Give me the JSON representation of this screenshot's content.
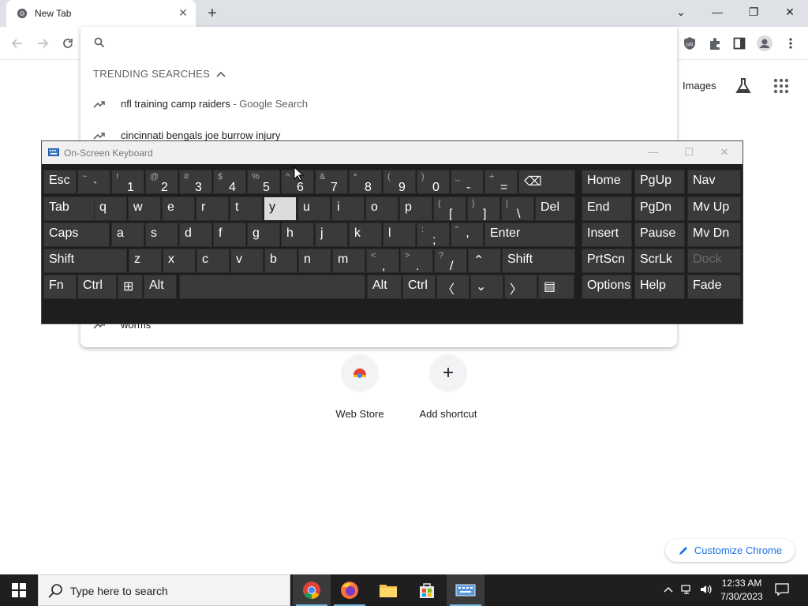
{
  "browser": {
    "tab_title": "New Tab",
    "tab_close": "✕",
    "new_tab": "+",
    "window_controls": {
      "dropdown": "⌄",
      "minimize": "—",
      "restore": "❐",
      "close": "✕"
    }
  },
  "omnibox": {
    "trending_header": "TRENDING SEARCHES",
    "suggestions": [
      {
        "text": "nfl training camp raiders",
        "suffix": " - Google Search"
      },
      {
        "text": "cincinnati bengals joe burrow injury",
        "suffix": ""
      },
      {
        "text": "worms",
        "suffix": ""
      }
    ]
  },
  "ntp": {
    "images_link": "Images",
    "shortcuts": [
      {
        "label": "Web Store"
      },
      {
        "label": "Add shortcut",
        "glyph": "+"
      }
    ],
    "customize": "Customize Chrome"
  },
  "osk": {
    "title": "On-Screen Keyboard",
    "window_controls": {
      "minimize": "—",
      "maximize": "☐",
      "close": "✕"
    },
    "rows": [
      [
        {
          "label": "Esc"
        },
        {
          "shift": "~",
          "main": "`"
        },
        {
          "shift": "!",
          "main": "1"
        },
        {
          "shift": "@",
          "main": "2"
        },
        {
          "shift": "#",
          "main": "3"
        },
        {
          "shift": "$",
          "main": "4"
        },
        {
          "shift": "%",
          "main": "5"
        },
        {
          "shift": "^",
          "main": "6"
        },
        {
          "shift": "&",
          "main": "7"
        },
        {
          "shift": "*",
          "main": "8"
        },
        {
          "shift": "(",
          "main": "9"
        },
        {
          "shift": ")",
          "main": "0"
        },
        {
          "shift": "_",
          "main": "-"
        },
        {
          "shift": "+",
          "main": "="
        },
        {
          "label": "⌫"
        },
        {
          "label": "Home"
        },
        {
          "label": "PgUp"
        },
        {
          "label": "Nav"
        }
      ],
      [
        {
          "label": "Tab"
        },
        {
          "label": "q"
        },
        {
          "label": "w"
        },
        {
          "label": "e"
        },
        {
          "label": "r"
        },
        {
          "label": "t"
        },
        {
          "label": "y",
          "pressed": true
        },
        {
          "label": "u"
        },
        {
          "label": "i"
        },
        {
          "label": "o"
        },
        {
          "label": "p"
        },
        {
          "shift": "{",
          "main": "["
        },
        {
          "shift": "}",
          "main": "]"
        },
        {
          "shift": "|",
          "main": "\\"
        },
        {
          "label": "Del"
        },
        {
          "label": "End"
        },
        {
          "label": "PgDn"
        },
        {
          "label": "Mv Up"
        }
      ],
      [
        {
          "label": "Caps"
        },
        {
          "label": "a"
        },
        {
          "label": "s"
        },
        {
          "label": "d"
        },
        {
          "label": "f"
        },
        {
          "label": "g"
        },
        {
          "label": "h"
        },
        {
          "label": "j"
        },
        {
          "label": "k"
        },
        {
          "label": "l"
        },
        {
          "shift": ":",
          "main": ";"
        },
        {
          "shift": "\"",
          "main": "'"
        },
        {
          "label": "Enter"
        },
        {
          "label": "Insert"
        },
        {
          "label": "Pause"
        },
        {
          "label": "Mv Dn"
        }
      ],
      [
        {
          "label": "Shift"
        },
        {
          "label": "z"
        },
        {
          "label": "x"
        },
        {
          "label": "c"
        },
        {
          "label": "v"
        },
        {
          "label": "b"
        },
        {
          "label": "n"
        },
        {
          "label": "m"
        },
        {
          "shift": "<",
          "main": ","
        },
        {
          "shift": ">",
          "main": "."
        },
        {
          "shift": "?",
          "main": "/"
        },
        {
          "label": "⌃"
        },
        {
          "label": "Shift"
        },
        {
          "label": "PrtScn"
        },
        {
          "label": "ScrLk"
        },
        {
          "label": "Dock",
          "disabled": true
        }
      ],
      [
        {
          "label": "Fn"
        },
        {
          "label": "Ctrl"
        },
        {
          "label": "⊞"
        },
        {
          "label": "Alt"
        },
        {
          "label": ""
        },
        {
          "label": "Alt"
        },
        {
          "label": "Ctrl"
        },
        {
          "label": "〈"
        },
        {
          "label": "⌄"
        },
        {
          "label": "〉"
        },
        {
          "label": "▤"
        },
        {
          "label": "Options"
        },
        {
          "label": "Help"
        },
        {
          "label": "Fade"
        }
      ]
    ]
  },
  "taskbar": {
    "search_placeholder": "Type here to search",
    "time": "12:33 AM",
    "date": "7/30/2023"
  },
  "colors": {
    "accent": "#1a73e8",
    "osk_bg": "#1e1e1e",
    "key_bg": "#3a3a3a",
    "taskbar": "#1f1f1f"
  }
}
